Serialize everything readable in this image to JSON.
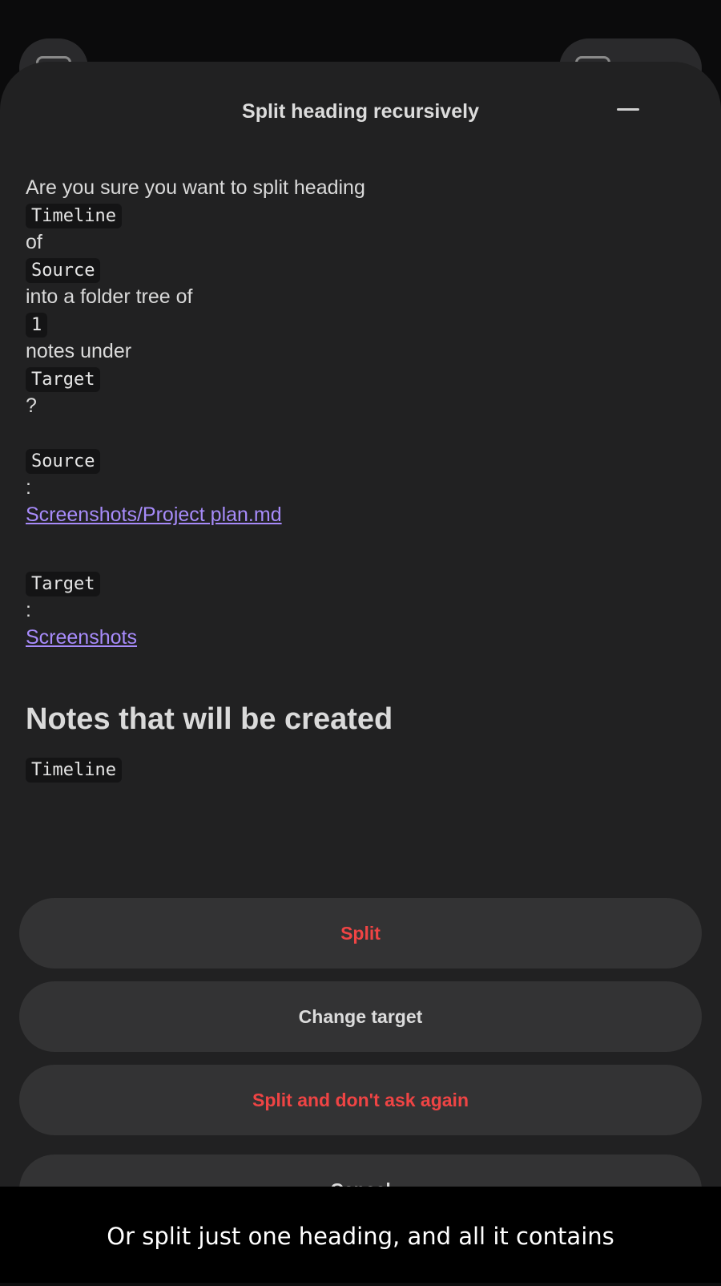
{
  "modal": {
    "title": "Split heading recursively",
    "intro": "Are you sure you want to split heading",
    "heading_name": "Timeline",
    "of_word": "of",
    "source_code": "Source",
    "into_text": "into a folder tree of",
    "count": "1",
    "notes_under": "notes under",
    "target_code": "Target",
    "question_mark": "?",
    "source_label": "Source",
    "colon": ":",
    "source_link": "Screenshots/Project plan.md",
    "target_label": "Target",
    "target_link": "Screenshots",
    "notes_heading": "Notes that will be created",
    "notes": [
      "Timeline"
    ]
  },
  "buttons": {
    "split": "Split",
    "change_target": "Change target",
    "split_no_ask": "Split and don't ask again",
    "cancel": "Cancel"
  },
  "caption": "Or split just one heading, and all it contains",
  "colors": {
    "sheet_bg": "#212122",
    "button_bg": "#333334",
    "danger": "#ef4444",
    "link": "#a78bfa"
  }
}
